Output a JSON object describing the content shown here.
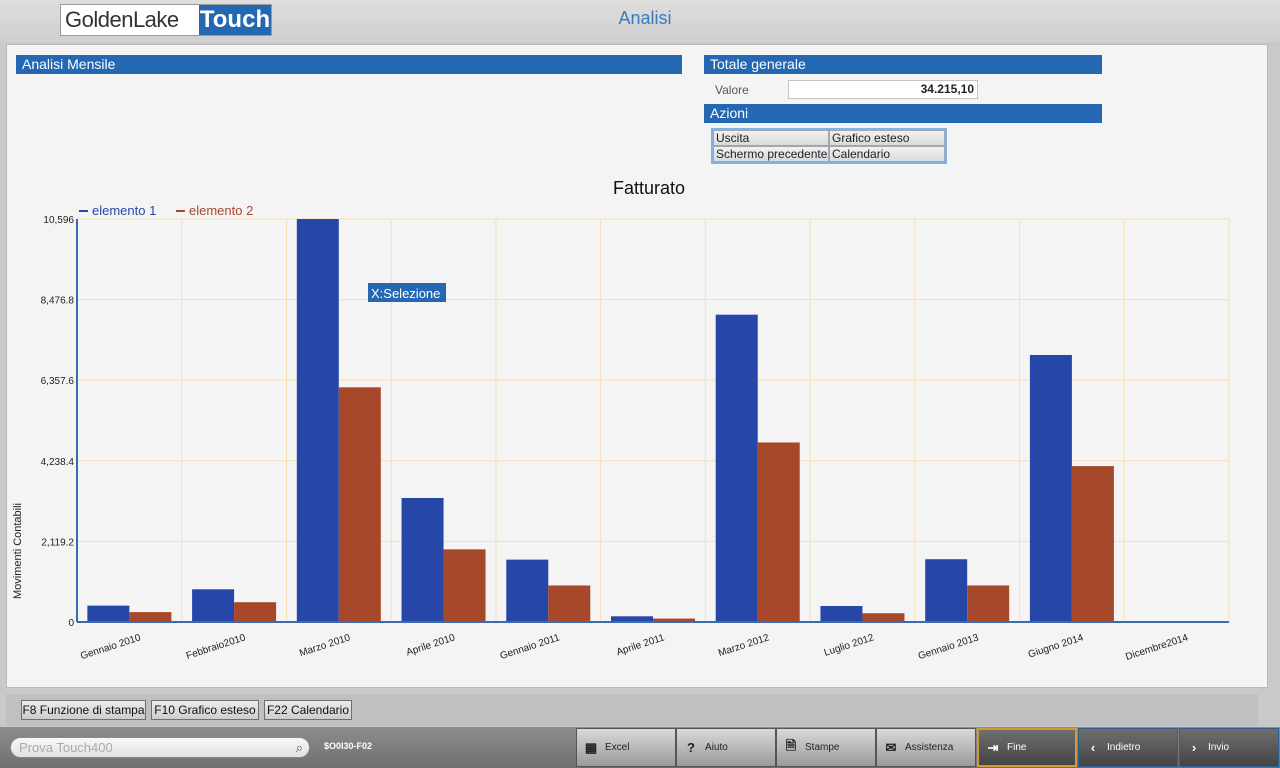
{
  "logo": {
    "part1": "GoldenLake",
    "part2": "Touch"
  },
  "app_title": "Analisi",
  "sections": {
    "analisi_mensile": "Analisi Mensile",
    "totale_generale": "Totale generale",
    "valore_label": "Valore",
    "valore": "34.215,10",
    "azioni": "Azioni"
  },
  "actions": [
    "Uscita",
    "Grafico esteso",
    "Schermo precedente",
    "Calendario"
  ],
  "tooltip": "X:Selezione",
  "chart_data": {
    "type": "bar",
    "title": "Fatturato",
    "ylabel": "Movimenti Contabili",
    "xlabel": "",
    "categories": [
      "Gennaio 2010",
      "Febbraio2010",
      "Marzo  2010",
      "Aprile  2010",
      "Gennaio 2011",
      "Aprile  2011",
      "Marzo   2012",
      "Luglio  2012",
      "Gennaio 2013",
      "Giugno  2014",
      "Dicembre2014"
    ],
    "series": [
      {
        "name": "elemento 1",
        "color": "#2647a8",
        "values": [
          430,
          860,
          10596,
          3260,
          1640,
          150,
          8080,
          420,
          1650,
          7020,
          0
        ]
      },
      {
        "name": "elemento 2",
        "color": "#a8482a",
        "values": [
          260,
          520,
          6170,
          1910,
          960,
          90,
          4720,
          230,
          960,
          4100,
          0
        ]
      }
    ],
    "yticks": [
      "0",
      "2,119.2",
      "4,238.4",
      "6,357.6",
      "8,476.8",
      "10,596"
    ],
    "ylim": [
      0,
      10596
    ],
    "grid": true,
    "legend": "top-left"
  },
  "fkeys": [
    "F8 Funzione di stampa",
    "F10 Grafico esteso",
    "F22 Calendario"
  ],
  "search_placeholder": "Prova Touch400",
  "program_code": "$O0I30-F02",
  "bottom_buttons": [
    {
      "label": "Excel",
      "icon": "grid-icon"
    },
    {
      "label": "Aiuto",
      "icon": "question-icon"
    },
    {
      "label": "Stampe",
      "icon": "document-icon"
    },
    {
      "label": "Assistenza",
      "icon": "mail-icon"
    },
    {
      "label": "Fine",
      "icon": "exit-icon"
    },
    {
      "label": "Indietro",
      "icon": "chevron-left-icon"
    },
    {
      "label": "Invio",
      "icon": "chevron-right-icon"
    }
  ]
}
